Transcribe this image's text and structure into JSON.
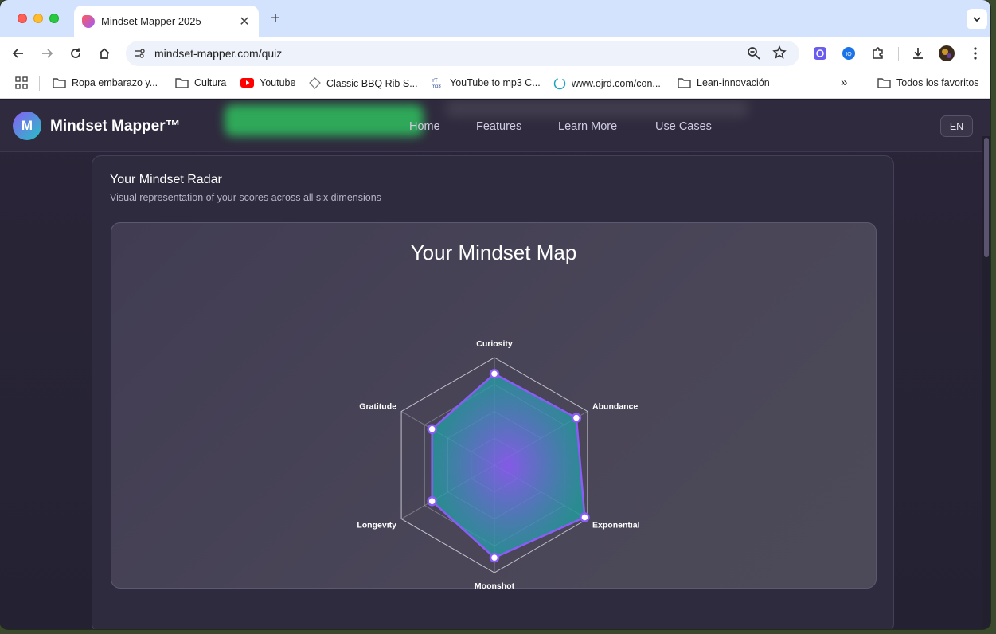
{
  "browser": {
    "tab_title": "Mindset Mapper 2025",
    "url": "mindset-mapper.com/quiz",
    "bookmarks": [
      {
        "label": "Ropa embarazo y...",
        "icon": "folder-icon"
      },
      {
        "label": "Cultura",
        "icon": "folder-icon"
      },
      {
        "label": "Youtube",
        "icon": "youtube-icon"
      },
      {
        "label": "Classic BBQ Rib S...",
        "icon": "site-icon"
      },
      {
        "label": "YouTube to mp3 C...",
        "icon": "yt-mp3-icon"
      },
      {
        "label": "www.ojrd.com/con...",
        "icon": "site-icon"
      },
      {
        "label": "Lean-innovación",
        "icon": "folder-icon"
      }
    ],
    "all_bookmarks": "Todos los favoritos"
  },
  "site": {
    "logo_letter": "M",
    "brand": "Mindset Mapper™",
    "nav": [
      "Home",
      "Features",
      "Learn More",
      "Use Cases"
    ],
    "language": "EN"
  },
  "card": {
    "title": "Your Mindset Radar",
    "subtitle": "Visual representation of your scores across all six dimensions"
  },
  "chart_data": {
    "type": "radar",
    "title": "Your Mindset Map",
    "axes": [
      "Curiosity",
      "Abundance",
      "Exponential",
      "Moonshot",
      "Longevity",
      "Gratitude"
    ],
    "series": [
      {
        "values": [
          85,
          88,
          97,
          86,
          67,
          67
        ]
      }
    ],
    "range": [
      0,
      100
    ],
    "rings": 4,
    "colors": {
      "line": "#8b5cf6",
      "fill_center": "#8b5cf6",
      "fill_edge": "#1fa3a3",
      "grid": "#d8d6e2"
    }
  }
}
